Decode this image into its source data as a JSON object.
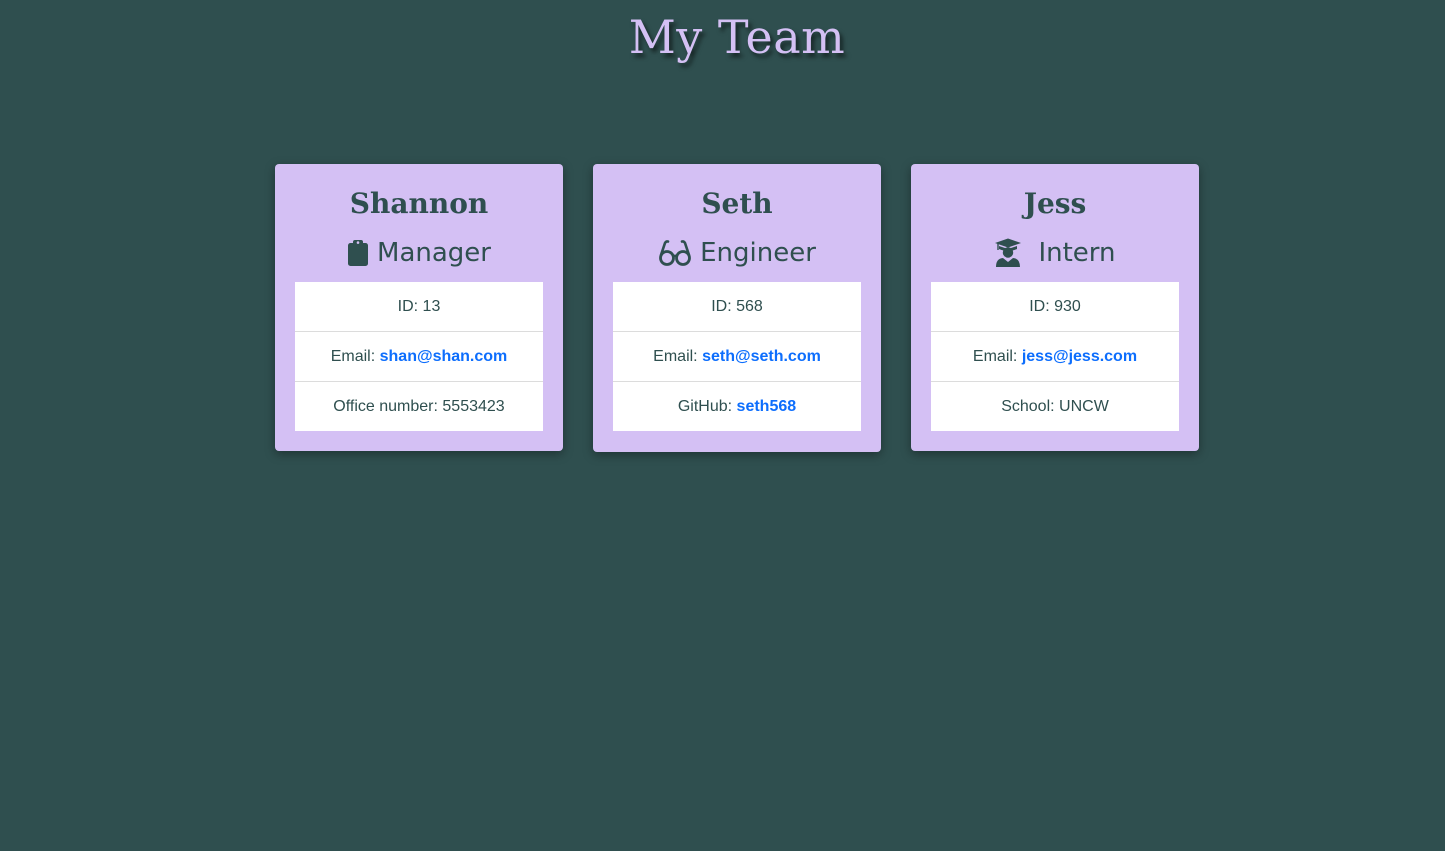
{
  "header": {
    "title": "My Team"
  },
  "colors": {
    "background": "#2f4f4f",
    "card": "#d4c0f4",
    "link": "#0d6efd",
    "text": "#2f4f4f"
  },
  "employees": [
    {
      "name": "Shannon",
      "role": "Manager",
      "role_icon": "clipboard-icon",
      "id_label": "ID:",
      "id": "13",
      "email_label": "Email:",
      "email": "shan@shan.com",
      "extra_label": "Office number:",
      "extra_value": "5553423"
    },
    {
      "name": "Seth",
      "role": "Engineer",
      "role_icon": "glasses-icon",
      "id_label": "ID:",
      "id": "568",
      "email_label": "Email:",
      "email": "seth@seth.com",
      "extra_label": "GitHub:",
      "extra_value": "seth568"
    },
    {
      "name": "Jess",
      "role": "Intern",
      "role_icon": "graduate-icon",
      "id_label": "ID:",
      "id": "930",
      "email_label": "Email:",
      "email": "jess@jess.com",
      "extra_label": "School:",
      "extra_value": "UNCW"
    }
  ]
}
